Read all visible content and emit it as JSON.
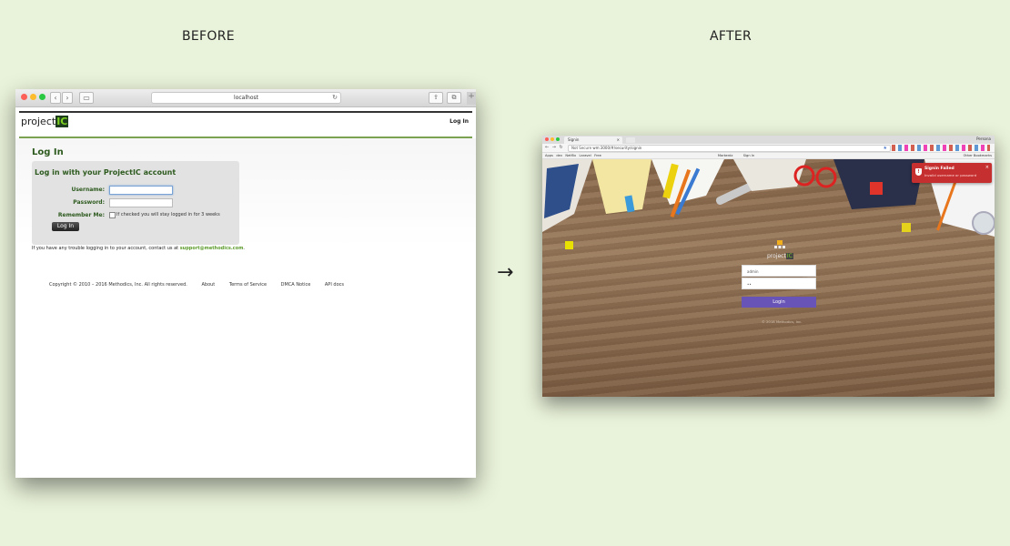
{
  "headings": {
    "before": "BEFORE",
    "after": "AFTER"
  },
  "arrow": "→",
  "before": {
    "browser": {
      "url": "localhost"
    },
    "site": {
      "logo_text": "project",
      "logo_badge": "IC",
      "header_login_link": "Log In",
      "page_title": "Log In",
      "panel_title": "Log in with your ProjectIC account",
      "username_label": "Username:",
      "password_label": "Password:",
      "remember_label": "Remember Me:",
      "remember_note": "If checked you will stay logged in for 3 weeks",
      "login_button": "Log In",
      "help_text": "If you have any trouble logging in to your account, contact us at",
      "support_email": "support@methodics.com",
      "help_period": ".",
      "footer": {
        "copyright": "Copyright © 2010 – 2016 Methodics, Inc. All rights reserved.",
        "links": [
          "About",
          "Terms of Service",
          "DMCA Notice",
          "API docs"
        ]
      }
    }
  },
  "after": {
    "browser": {
      "tab_title": "Signin",
      "person": "Persona",
      "not_secure": "Not Secure",
      "url": "wm:3000/#/security/signin",
      "bookmarks": [
        "Apps",
        "dev",
        "Netflix",
        "Laravel",
        "Free",
        "Markerdz",
        "Sign In"
      ],
      "other_bookmarks": "Other Bookmarks"
    },
    "toast": {
      "title": "Signin Failed",
      "message": "Invalid username or password"
    },
    "logo_text": "project",
    "logo_badge": "IC",
    "username_value": "admin",
    "password_value": "••",
    "login_button": "Login",
    "footer": "© 2018 Methodics, Inc."
  }
}
